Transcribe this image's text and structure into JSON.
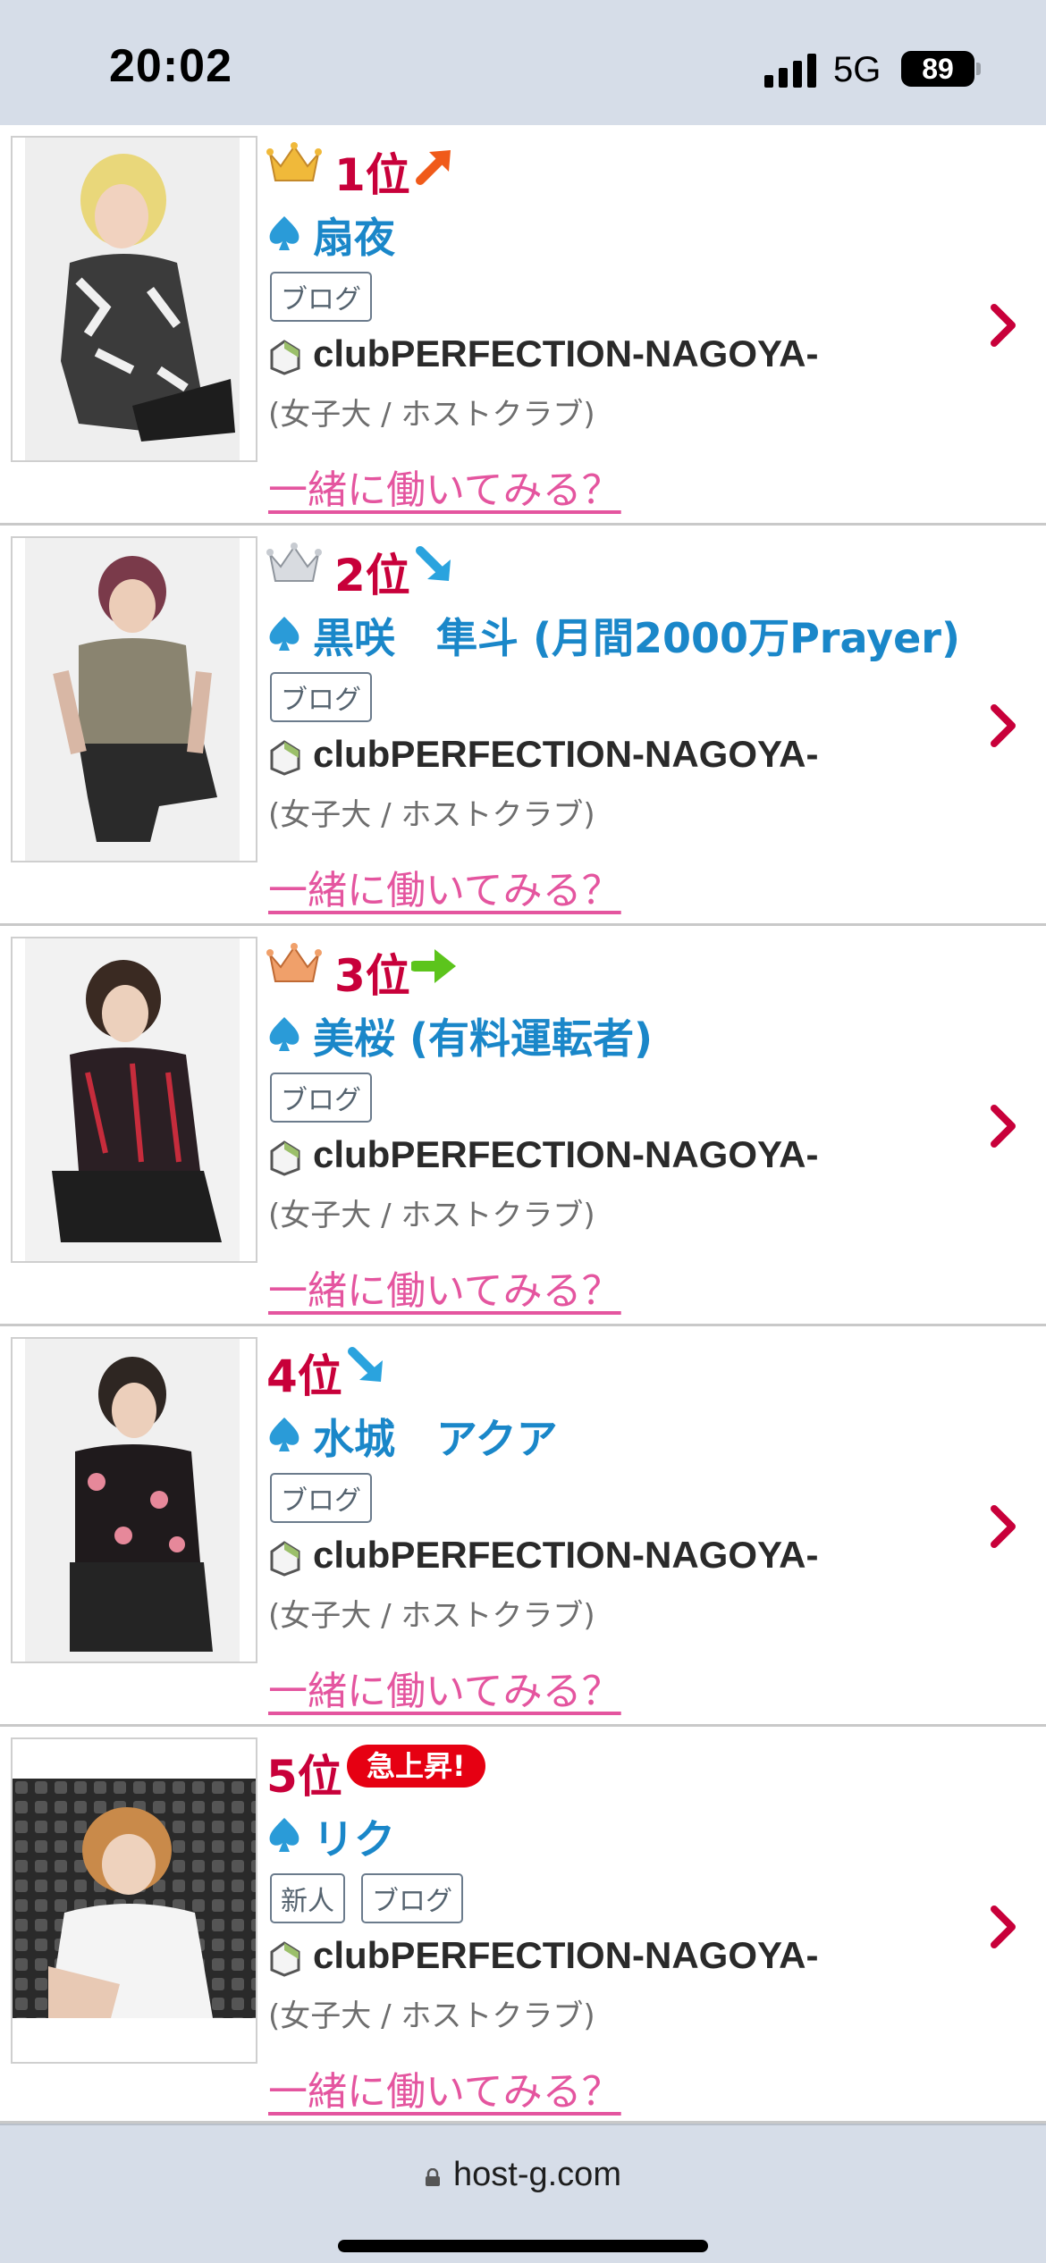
{
  "status_bar": {
    "time": "20:02",
    "network": "5G",
    "battery": "89"
  },
  "browser": {
    "url": "host-g.com"
  },
  "common": {
    "club": "clubPERFECTION-NAGOYA-",
    "sub": "(女子大 / ホストクラブ)",
    "work_link": "一緒に働いてみる？"
  },
  "rankings": [
    {
      "rank": "1位",
      "crown": "gold-crown-icon",
      "trend": "up",
      "name": "扇夜",
      "tags": [
        "ブログ"
      ]
    },
    {
      "rank": "2位",
      "crown": "silver-crown-icon",
      "trend": "down",
      "name": "黒咲　隼斗 (月間2000万Prayer)",
      "tags": [
        "ブログ"
      ]
    },
    {
      "rank": "3位",
      "crown": "bronze-crown-icon",
      "trend": "same",
      "name": "美桜 (有料運転者)",
      "tags": [
        "ブログ"
      ]
    },
    {
      "rank": "4位",
      "crown": "",
      "trend": "down",
      "name": "水城　アクア",
      "tags": [
        "ブログ"
      ]
    },
    {
      "rank": "5位",
      "crown": "",
      "trend": "",
      "badge": "急上昇!",
      "name": "リク",
      "tags": [
        "新人",
        "ブログ"
      ]
    }
  ],
  "colors": {
    "rank": "#c8003a",
    "name": "#1a87c9",
    "link": "#e4559f",
    "chevron": "#c8003a",
    "status_bg": "#d6dde8"
  }
}
